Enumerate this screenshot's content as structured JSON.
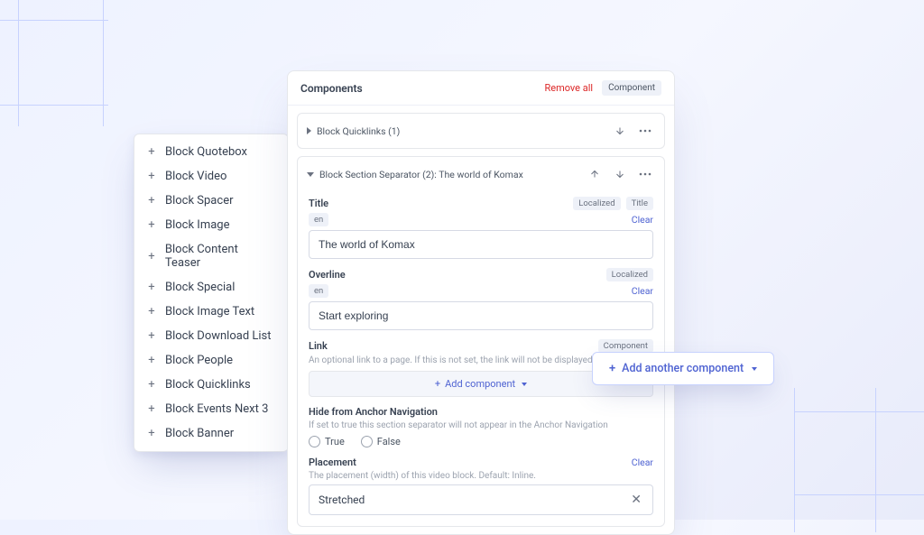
{
  "picker": {
    "items": [
      "Block Quotebox",
      "Block Video",
      "Block Spacer",
      "Block Image",
      "Block Content Teaser",
      "Block Special",
      "Block Image Text",
      "Block Download List",
      "Block People",
      "Block Quicklinks",
      "Block Events Next 3",
      "Block Banner"
    ]
  },
  "panel": {
    "title": "Components",
    "remove_all": "Remove all",
    "type_badge": "Component",
    "section1": {
      "title": "Block Quicklinks (1)"
    },
    "section2": {
      "title": "Block Section Separator (2): The world of Komax",
      "fields": {
        "title": {
          "label": "Title",
          "badge1": "Localized",
          "badge2": "Title",
          "lang": "en",
          "clear": "Clear",
          "value": "The world of Komax"
        },
        "overline": {
          "label": "Overline",
          "badge": "Localized",
          "lang": "en",
          "clear": "Clear",
          "value": "Start exploring"
        },
        "link": {
          "label": "Link",
          "badge": "Component",
          "help": "An optional link to a page. If this is not set, the link will not be displayed.",
          "add_label": "Add component"
        },
        "hide": {
          "label": "Hide from Anchor Navigation",
          "help": "If set to true this section separator will not appear in the Anchor Navigation",
          "true": "True",
          "false": "False"
        },
        "placement": {
          "label": "Placement",
          "clear": "Clear",
          "help": "The placement (width) of this video block. Default: Inline.",
          "value": "Stretched"
        }
      }
    }
  },
  "add_another": "Add another component"
}
